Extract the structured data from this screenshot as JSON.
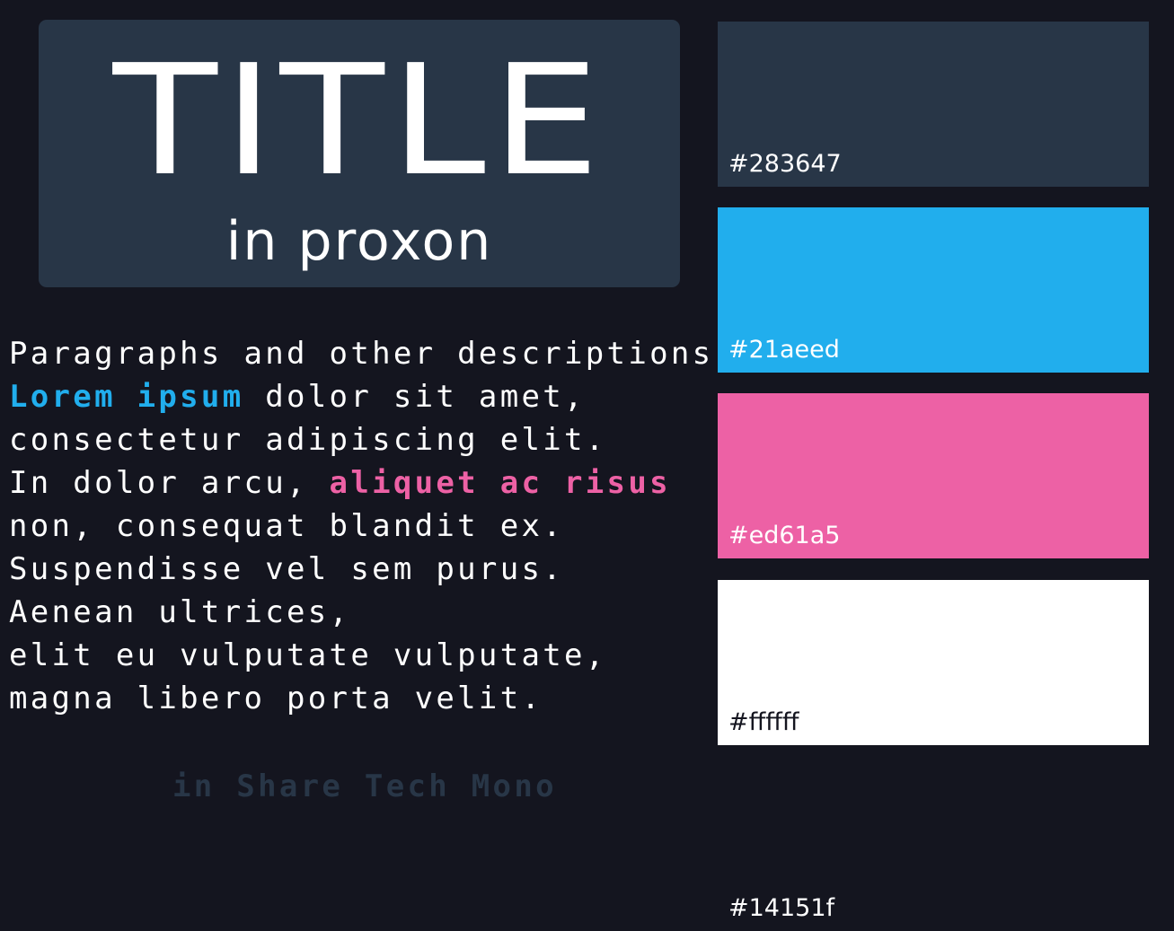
{
  "title_card": {
    "title": "TITLE",
    "subtitle": "in proxon"
  },
  "paragraph": {
    "line1": "Paragraphs and other descriptions.",
    "line2_highlight": "Lorem ipsum",
    "line2_rest": " dolor sit amet,",
    "line3": "consectetur adipiscing elit.",
    "line4_start": "In dolor arcu, ",
    "line4_highlight": "aliquet ac risus",
    "line5": "non, consequat blandit ex.",
    "line6": "Suspendisse vel sem purus.",
    "line7": "Aenean ultrices,",
    "line8": "elit eu vulputate vulputate,",
    "line9": "magna libero porta velit."
  },
  "font_note": "in Share Tech Mono",
  "palette": [
    {
      "label": "#283647",
      "color": "#283647",
      "text_color": "#ffffff"
    },
    {
      "label": "#21aeed",
      "color": "#21aeed",
      "text_color": "#ffffff"
    },
    {
      "label": "#ed61a5",
      "color": "#ed61a5",
      "text_color": "#ffffff"
    },
    {
      "label": "#ffffff",
      "color": "#ffffff",
      "text_color": "#14151f"
    },
    {
      "label": "#14151f",
      "color": "#14151f",
      "text_color": "#ffffff"
    }
  ]
}
